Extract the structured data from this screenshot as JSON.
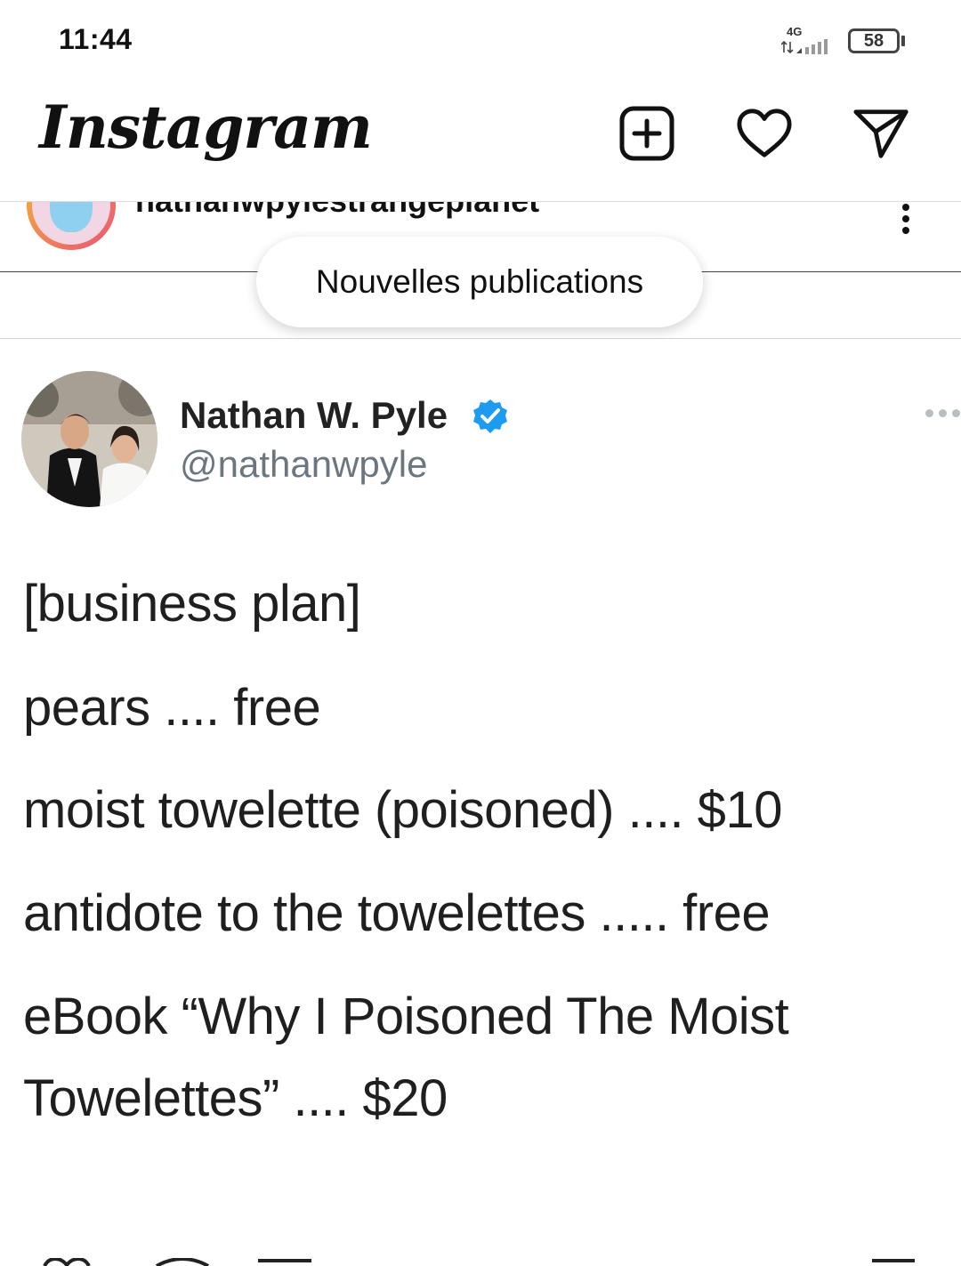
{
  "status_bar": {
    "time": "11:44",
    "network": "4G",
    "battery": "58"
  },
  "header": {
    "logo": "Instagram",
    "icons": [
      "add-post-icon",
      "heart-icon",
      "direct-message-icon"
    ]
  },
  "previous_post": {
    "username": "nathanwpylestrangeplanet"
  },
  "new_posts_pill": {
    "label": "Nouvelles publications"
  },
  "tweet": {
    "author_name": "Nathan W. Pyle",
    "handle": "@nathanwpyle",
    "verified": true,
    "lines": [
      "[business plan]",
      "pears  ....  free",
      "moist towelette (poisoned) .... $10",
      "antidote to the towelettes ..... free",
      "eBook “Why I Poisoned The Moist",
      "Towelettes”  ....   $20"
    ]
  },
  "colors": {
    "verified_blue": "#1d9bf0",
    "handle_gray": "#6b7680",
    "divider": "#dcdcdc"
  }
}
